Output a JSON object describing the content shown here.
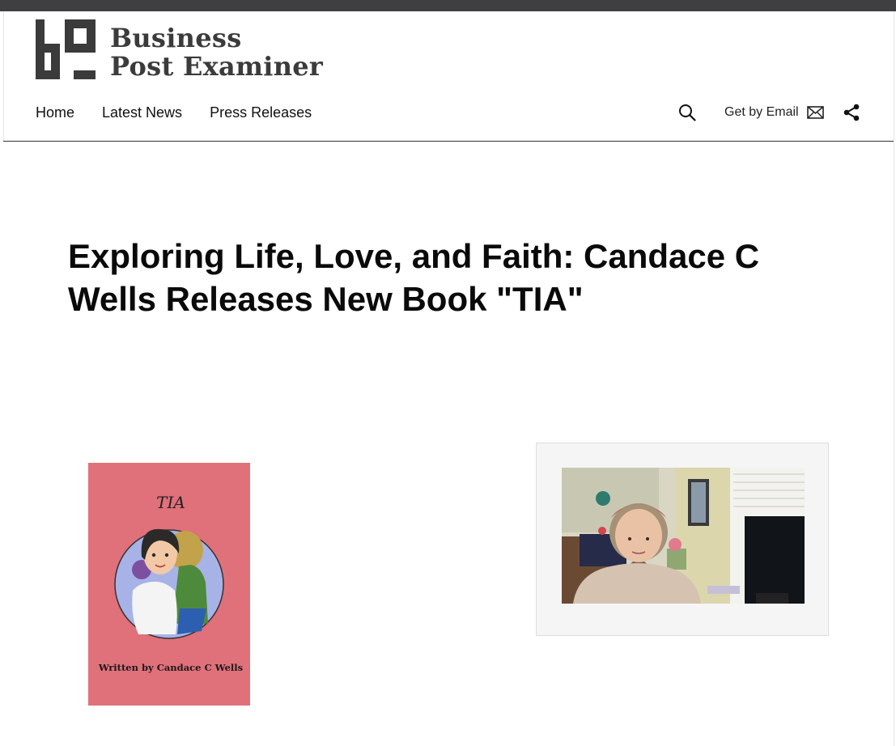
{
  "site": {
    "logo_line1": "Business",
    "logo_line2": "Post Examiner"
  },
  "nav": {
    "items": [
      "Home",
      "Latest News",
      "Press Releases"
    ]
  },
  "header_actions": {
    "search_icon": "search-icon",
    "email_label": "Get by Email",
    "email_icon": "envelope-icon",
    "share_icon": "share-icon"
  },
  "article": {
    "title": "Exploring Life, Love, and Faith: Candace C Wells Releases New Book \"TIA\""
  },
  "book": {
    "title": "TIA",
    "byline": "Written by Candace C Wells",
    "cover_color": "#e0707a"
  },
  "colors": {
    "topbar": "#3f3e40",
    "logo": "#3b3b3b"
  }
}
